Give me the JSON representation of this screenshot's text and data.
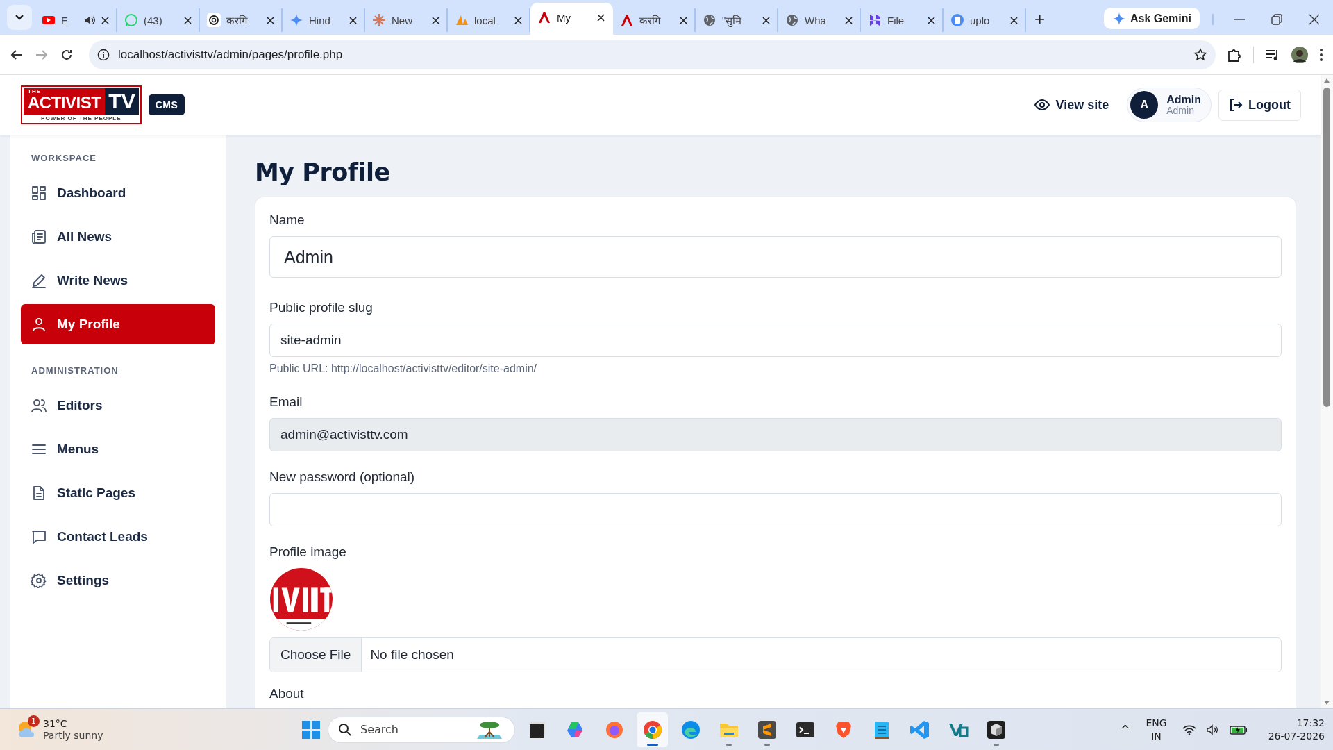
{
  "browser": {
    "tabs": [
      {
        "title": "E",
        "kind": "youtube",
        "audio": true,
        "selected": false
      },
      {
        "title": "(43)",
        "kind": "whatsapp",
        "audio": false,
        "selected": false
      },
      {
        "title": "करगि",
        "kind": "openai",
        "audio": false,
        "selected": false
      },
      {
        "title": "Hind",
        "kind": "sparkle",
        "audio": false,
        "selected": false
      },
      {
        "title": "New",
        "kind": "burst",
        "audio": false,
        "selected": false
      },
      {
        "title": "local",
        "kind": "pma",
        "audio": false,
        "selected": false
      },
      {
        "title": "My",
        "kind": "activist",
        "audio": false,
        "selected": true
      },
      {
        "title": "करगि",
        "kind": "activist",
        "audio": false,
        "selected": false
      },
      {
        "title": "\"सुमि",
        "kind": "globe",
        "audio": false,
        "selected": false
      },
      {
        "title": "Wha",
        "kind": "globe",
        "audio": false,
        "selected": false
      },
      {
        "title": "File",
        "kind": "hostinger",
        "audio": false,
        "selected": false
      },
      {
        "title": "uplo",
        "kind": "disk",
        "audio": false,
        "selected": false
      }
    ],
    "new_tab": "+",
    "ask_gemini": "Ask Gemini",
    "url": "localhost/activisttv/admin/pages/profile.php"
  },
  "header": {
    "logo": {
      "top": "THE",
      "main": "ACTIVIST",
      "tv": "TV",
      "tagline": "POWER OF THE PEOPLE"
    },
    "badge": "CMS",
    "view_site": "View site",
    "user": {
      "initial": "A",
      "name": "Admin",
      "role": "Admin"
    },
    "logout": "Logout"
  },
  "sidebar": {
    "sections": [
      {
        "heading": "WORKSPACE",
        "items": [
          {
            "label": "Dashboard",
            "kind": "grid",
            "selected": false
          },
          {
            "label": "All News",
            "kind": "news",
            "selected": false
          },
          {
            "label": "Write News",
            "kind": "pen",
            "selected": false
          },
          {
            "label": "My Profile",
            "kind": "user",
            "selected": true
          }
        ]
      },
      {
        "heading": "ADMINISTRATION",
        "items": [
          {
            "label": "Editors",
            "kind": "users",
            "selected": false
          },
          {
            "label": "Menus",
            "kind": "menu",
            "selected": false
          },
          {
            "label": "Static Pages",
            "kind": "page",
            "selected": false
          },
          {
            "label": "Contact Leads",
            "kind": "chat",
            "selected": false
          },
          {
            "label": "Settings",
            "kind": "gear",
            "selected": false
          }
        ]
      }
    ]
  },
  "page": {
    "title": "My Profile",
    "fields": [
      {
        "kind": "large",
        "label": "Name",
        "value": "Admin"
      },
      {
        "kind": "text",
        "label": "Public profile slug",
        "value": "site-admin",
        "help": "Public URL: http://localhost/activisttv/editor/site-admin/"
      },
      {
        "kind": "readonly",
        "label": "Email",
        "value": "admin@activisttv.com"
      },
      {
        "kind": "password",
        "label": "New password (optional)"
      },
      {
        "kind": "file",
        "label": "Profile image",
        "button": "Choose File",
        "status": "No file chosen"
      },
      {
        "kind": "label",
        "label": "About"
      }
    ]
  },
  "taskbar": {
    "weather": {
      "badge": "1",
      "temp": "31°C",
      "condition": "Partly sunny"
    },
    "search": {
      "placeholder": "Search"
    },
    "apps": [
      {
        "kind": "taskview",
        "running": false,
        "selected": false
      },
      {
        "kind": "copilot",
        "running": false,
        "selected": false
      },
      {
        "kind": "firefox",
        "running": false,
        "selected": false
      },
      {
        "kind": "chrome",
        "running": true,
        "selected": true
      },
      {
        "kind": "edge",
        "running": false,
        "selected": false
      },
      {
        "kind": "explorer",
        "running": true,
        "selected": false
      },
      {
        "kind": "sublime",
        "running": true,
        "selected": false
      },
      {
        "kind": "terminal",
        "running": false,
        "selected": false
      },
      {
        "kind": "brave",
        "running": false,
        "selected": false
      },
      {
        "kind": "notepad",
        "running": false,
        "selected": false
      },
      {
        "kind": "vscode",
        "running": false,
        "selected": false
      },
      {
        "kind": "vstudio",
        "running": false,
        "selected": false
      },
      {
        "kind": "cube",
        "running": true,
        "selected": false
      }
    ],
    "tray": {
      "chevron": "^",
      "lang": "ENG",
      "region": "IN",
      "time": "17:32",
      "date": "26-07-2026"
    }
  }
}
